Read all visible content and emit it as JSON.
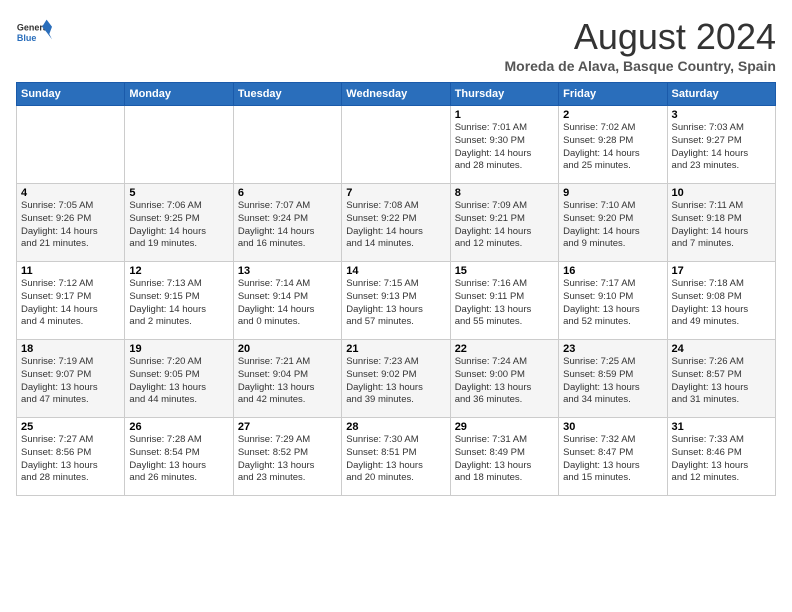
{
  "header": {
    "logo_line1": "General",
    "logo_line2": "Blue",
    "month_year": "August 2024",
    "location": "Moreda de Alava, Basque Country, Spain"
  },
  "weekdays": [
    "Sunday",
    "Monday",
    "Tuesday",
    "Wednesday",
    "Thursday",
    "Friday",
    "Saturday"
  ],
  "weeks": [
    [
      {
        "day": "",
        "info": ""
      },
      {
        "day": "",
        "info": ""
      },
      {
        "day": "",
        "info": ""
      },
      {
        "day": "",
        "info": ""
      },
      {
        "day": "1",
        "info": "Sunrise: 7:01 AM\nSunset: 9:30 PM\nDaylight: 14 hours\nand 28 minutes."
      },
      {
        "day": "2",
        "info": "Sunrise: 7:02 AM\nSunset: 9:28 PM\nDaylight: 14 hours\nand 25 minutes."
      },
      {
        "day": "3",
        "info": "Sunrise: 7:03 AM\nSunset: 9:27 PM\nDaylight: 14 hours\nand 23 minutes."
      }
    ],
    [
      {
        "day": "4",
        "info": "Sunrise: 7:05 AM\nSunset: 9:26 PM\nDaylight: 14 hours\nand 21 minutes."
      },
      {
        "day": "5",
        "info": "Sunrise: 7:06 AM\nSunset: 9:25 PM\nDaylight: 14 hours\nand 19 minutes."
      },
      {
        "day": "6",
        "info": "Sunrise: 7:07 AM\nSunset: 9:24 PM\nDaylight: 14 hours\nand 16 minutes."
      },
      {
        "day": "7",
        "info": "Sunrise: 7:08 AM\nSunset: 9:22 PM\nDaylight: 14 hours\nand 14 minutes."
      },
      {
        "day": "8",
        "info": "Sunrise: 7:09 AM\nSunset: 9:21 PM\nDaylight: 14 hours\nand 12 minutes."
      },
      {
        "day": "9",
        "info": "Sunrise: 7:10 AM\nSunset: 9:20 PM\nDaylight: 14 hours\nand 9 minutes."
      },
      {
        "day": "10",
        "info": "Sunrise: 7:11 AM\nSunset: 9:18 PM\nDaylight: 14 hours\nand 7 minutes."
      }
    ],
    [
      {
        "day": "11",
        "info": "Sunrise: 7:12 AM\nSunset: 9:17 PM\nDaylight: 14 hours\nand 4 minutes."
      },
      {
        "day": "12",
        "info": "Sunrise: 7:13 AM\nSunset: 9:15 PM\nDaylight: 14 hours\nand 2 minutes."
      },
      {
        "day": "13",
        "info": "Sunrise: 7:14 AM\nSunset: 9:14 PM\nDaylight: 14 hours\nand 0 minutes."
      },
      {
        "day": "14",
        "info": "Sunrise: 7:15 AM\nSunset: 9:13 PM\nDaylight: 13 hours\nand 57 minutes."
      },
      {
        "day": "15",
        "info": "Sunrise: 7:16 AM\nSunset: 9:11 PM\nDaylight: 13 hours\nand 55 minutes."
      },
      {
        "day": "16",
        "info": "Sunrise: 7:17 AM\nSunset: 9:10 PM\nDaylight: 13 hours\nand 52 minutes."
      },
      {
        "day": "17",
        "info": "Sunrise: 7:18 AM\nSunset: 9:08 PM\nDaylight: 13 hours\nand 49 minutes."
      }
    ],
    [
      {
        "day": "18",
        "info": "Sunrise: 7:19 AM\nSunset: 9:07 PM\nDaylight: 13 hours\nand 47 minutes."
      },
      {
        "day": "19",
        "info": "Sunrise: 7:20 AM\nSunset: 9:05 PM\nDaylight: 13 hours\nand 44 minutes."
      },
      {
        "day": "20",
        "info": "Sunrise: 7:21 AM\nSunset: 9:04 PM\nDaylight: 13 hours\nand 42 minutes."
      },
      {
        "day": "21",
        "info": "Sunrise: 7:23 AM\nSunset: 9:02 PM\nDaylight: 13 hours\nand 39 minutes."
      },
      {
        "day": "22",
        "info": "Sunrise: 7:24 AM\nSunset: 9:00 PM\nDaylight: 13 hours\nand 36 minutes."
      },
      {
        "day": "23",
        "info": "Sunrise: 7:25 AM\nSunset: 8:59 PM\nDaylight: 13 hours\nand 34 minutes."
      },
      {
        "day": "24",
        "info": "Sunrise: 7:26 AM\nSunset: 8:57 PM\nDaylight: 13 hours\nand 31 minutes."
      }
    ],
    [
      {
        "day": "25",
        "info": "Sunrise: 7:27 AM\nSunset: 8:56 PM\nDaylight: 13 hours\nand 28 minutes."
      },
      {
        "day": "26",
        "info": "Sunrise: 7:28 AM\nSunset: 8:54 PM\nDaylight: 13 hours\nand 26 minutes."
      },
      {
        "day": "27",
        "info": "Sunrise: 7:29 AM\nSunset: 8:52 PM\nDaylight: 13 hours\nand 23 minutes."
      },
      {
        "day": "28",
        "info": "Sunrise: 7:30 AM\nSunset: 8:51 PM\nDaylight: 13 hours\nand 20 minutes."
      },
      {
        "day": "29",
        "info": "Sunrise: 7:31 AM\nSunset: 8:49 PM\nDaylight: 13 hours\nand 18 minutes."
      },
      {
        "day": "30",
        "info": "Sunrise: 7:32 AM\nSunset: 8:47 PM\nDaylight: 13 hours\nand 15 minutes."
      },
      {
        "day": "31",
        "info": "Sunrise: 7:33 AM\nSunset: 8:46 PM\nDaylight: 13 hours\nand 12 minutes."
      }
    ]
  ]
}
